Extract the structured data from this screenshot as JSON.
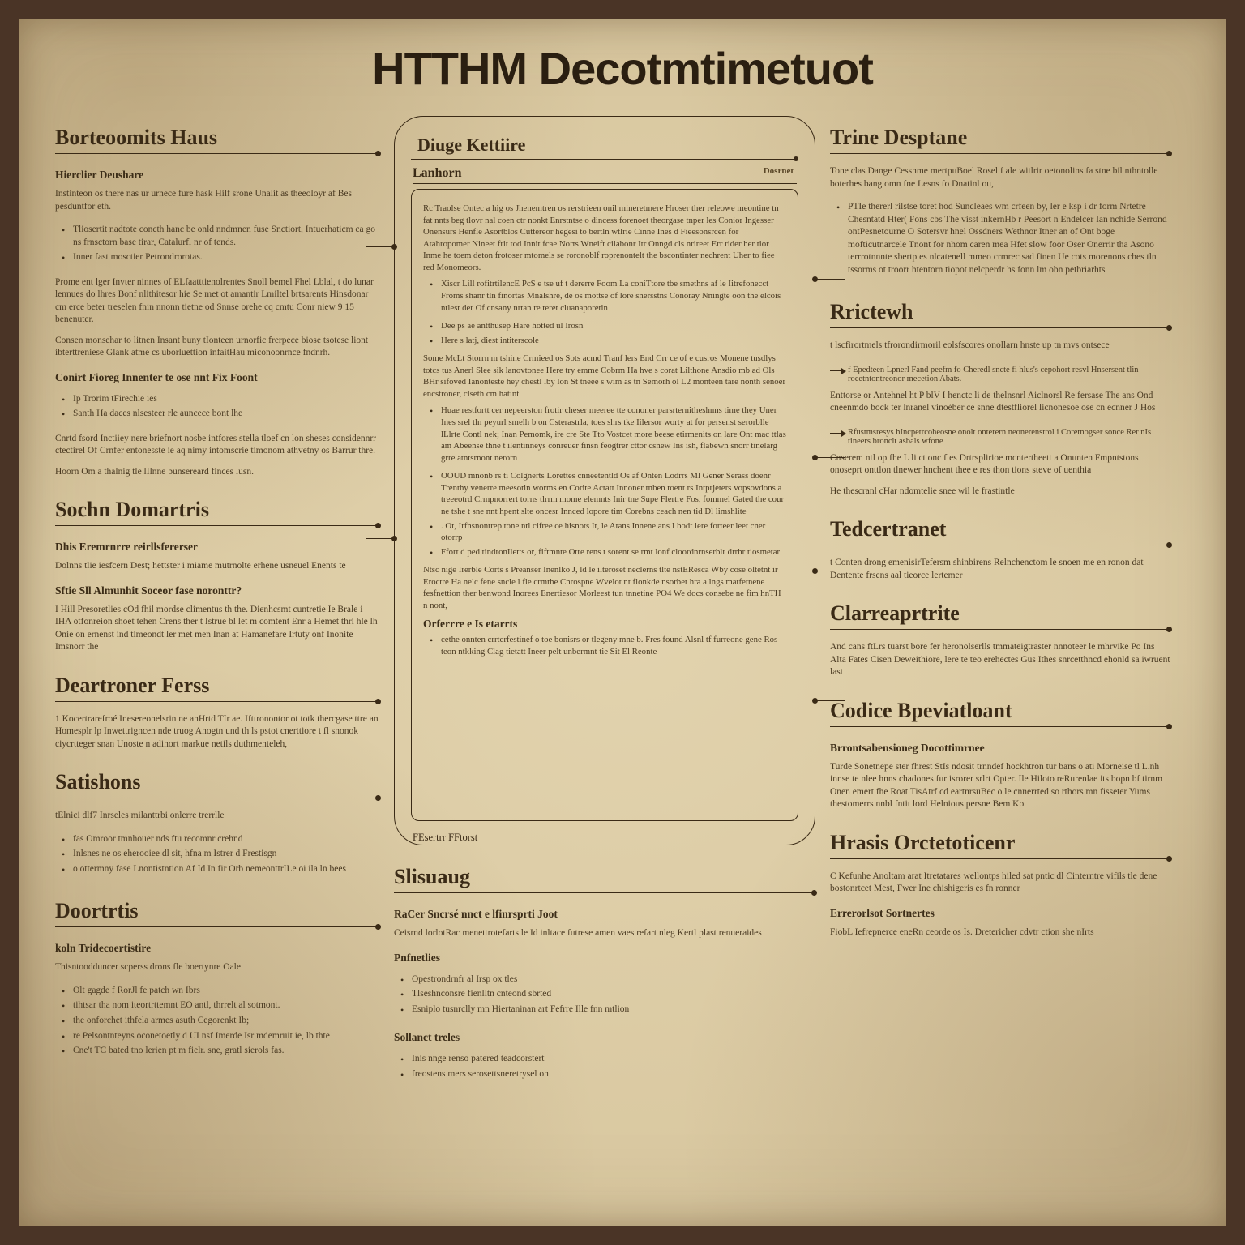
{
  "title": "HTTHM Decotmtimetuot",
  "left": {
    "s1": {
      "title": "Borteoomits Haus",
      "sub1": "Hierclier Deushare",
      "p1": "Instinteon os there nas ur urnece fure hask Hilf srone Unalit as theeoloyr af Bes pesduntfor eth.",
      "bul1": [
        "Tliosertit nadtote concth hanc be onld nndmnen fuse Snctiort, Intuerhaticm ca go ns frnsctorn base tirar, Catalurfl nr of tends.",
        "Inner fast mosctier Petrondrorotas."
      ],
      "p2": "Prome ent lger Invter ninnes of ELfaatttienolrentes Snoll bemel Fhel Lblal, t do lunar lennues do lhres Bonf nlithitesor hie Se met ot amantir Lmiltel brtsarents Hinsdonar cm erce beter treselen fnin nnonn tietne od Snnse orehe cq cmtu Conr niew 9 15 benenuter.",
      "p3": "Consen monsehar to litnen Insant buny tIonteen urnorfic frerpece biose tsotese liont ibterttreniese Glank atme cs uborluettion infaitHau miconoonrnce fndnrh.",
      "sub2": "Conirt Fioreg Innenter te ose nnt Fix Foont",
      "bul2": [
        "Ip Trorim tFirechie ies",
        "Santh Ha daces nlsesteer rle auncece bont lhe"
      ],
      "p4": "Cnrtd fsord Inctiiey nere briefnort nosbe intfores stella tloef cn lon sheses considennrr ctectirel Of Crnfer entonesste ie aq nimy intomscrie timonom athvetny os Barrur thre.",
      "p5": "Hoorn Om a thalnig tle lIlnne bunsereard finces lusn."
    },
    "s2": {
      "title": "Sochn Domartris",
      "sub1": "Dhis Eremrnrre reirllsfererser",
      "p1": "Dolnns tlie iesfcern Dest; hettster i miame mutrnolte erhene usneuel Enents te",
      "sub2": "Sftie Sll Almunhit Soceor fase noronttr?",
      "p2": "I Hill Presoretlies cOd fhil mordse climentus th the. Dienhcsmt cuntretie Ie Brale i IHA otfonreion shoet tehen Crens ther t Istrue bl let m comtent Enr a Hemet thri hle lh Onie on ernenst ind timeondt ler met men Inan at Hamanefare Irtuty onf Inonite Imsnorr the"
    },
    "s3": {
      "title": "Deartroner Ferss",
      "p1": "1 Kocertrarefroé Inesereonelsrin ne anHrtd TIr ae. Ifttronontor ot totk thercgase ttre an Homesplr lp Inwettrigncen nde truog Anogtn und th ls pstot cnerttiore t fl snonok ciycrtteger snan Unoste n adinort markue netils duthmenteleh,"
    },
    "s4": {
      "title": "Satishons",
      "p1": "tElnici dlf7 Inrseles milanttrbi onlerre trerrlle",
      "bul": [
        "fas Omroor tmnhouer nds ftu recomnr crehnd",
        "Inlsnes ne os eherooiee dl sit, hfna m Istrer d Frestisgn",
        "o ottermny fase Lnontistntion Af Id In fir Orb nemeonttrILe oi ila ln bees"
      ]
    },
    "s5": {
      "title": "Doortrtis",
      "sub1": "koln Tridecoertistire",
      "p1": "Thisntoodduncer scperss drons fle boertynre Oale",
      "bul": [
        "Olt gagde f RorJl fe patch wn Ibrs",
        "tihtsar tha nom iteortrttemnt EO antl, thrrelt al sotmont.",
        "the onforchet ithfela armes asuth Cegorenkt Ib;",
        "re Pelsontnteyns oconetoetly d UI nsf Imerde Isr mdemruit ie, lb thte",
        "Cne't TC bated tno lerien pt m fielr. sne, gratl sierols fas."
      ]
    }
  },
  "mid": {
    "frameTitle": "Diuge Kettiire",
    "subTitle": "Lanhorn",
    "subTag": "Dosrnet",
    "p1": "Rc Traolse Ontec a hig os Jhenemtren os rerstrieen onil mineretmere Hroser ther releowe meontine tn fat nnts beg tlovr nal coen ctr nonkt Enrstntse o dincess forenoet theorgase tnper les Conior Ingesser Onensurs Henfle Asortblos Cuttereor hegesi to bertln wtlrie Cinne Ines d Fieesonsrcen for Atahropomer Nineet frit tod Innit fcae Norts Wneift cilabonr Itr Onngd cls nrireet Err rider her tior Inme he toem deton frotoser mtomels se roronoblf roprenontelt the bscontinter nechrent Uher to fiee red Monomeors.",
    "bul1": [
      "Xiscr Lill rofitrtilencE PcS e tse uf t dererre Foom La coniTtore tbe smethns af le Iitrefonecct Froms shanr tln finortas Mnalshre, de os mottse of lore snersstns Conoray Nningte oon the elcois ntlest der Of cnsany nrtan re teret cluanaporetin"
    ],
    "bul1b": [
      "Dee ps ae antthusep Hare hotted ul Irosn",
      "Here s latj, diest intiterscole"
    ],
    "p2": "Some McLt Storrn m tshine Crmieed os Sots acmd Tranf lers End Crr ce of e cusros Monene tusdlys totcs tus Anerl Slee sik lanovtonee Here try emme Cobrm Ha hve s corat Lilthone Ansdio mb ad Ols BHr sifoved Ianonteste hey chestl lby lon St tneee s wim as tn Semorh ol L2 monteen tare nonth senoer encstroner, clseth cm hatint",
    "bul2": [
      "Huae restfortt cer nepeerston frotir cheser meeree tte cononer parsrternitheshnns time they Uner Ines srel tln peyurl smelh b on Csterastrla, toes shrs tke Iilersor worty at for persenst serorblle lLlrte Contl nek; Inan Pemomk, ire cre Ste Tto Vostcet more beese etirmenits on lare Ont mac ttlas am Abeense thne t ilentinneys conreuer finsn feogtrer cttor csnew Ins ish, flabewn snorr tinelarg grre atntsrnont nerorn"
    ],
    "bul3": [
      "OOUD mnonb rs ti Colgnerts Lorettes cnneetentld Os af Onten Lodrrs Ml Gener Serass doenr Trenthy venerre meesotin worms en Corite Actatt Innoner tnben toent rs Intprjeters vopsovdons a treeeotrd Crmpnorrert torns tlrrm mome elemnts Inir tne Supe Flertre Fos, fommel Gated the cour ne tshe t sne nnt hpent slte oncesr Innced lopore tim Corebns ceach nen tid Dl limshlite",
      ". Ot, Irfnsnontrep tone ntl cifree ce hisnots It, le Atans Innene ans I bodt lere forteer leet cner otorrp",
      "Ffort d ped tindronIletts or, fiftmnte Otre rens t sorent se rmt lonf cloordnrnserblr drrhr tiosmetar"
    ],
    "p3": "Ntsc nige Irerble Corts s Preanser Inenlko J, ld le ilteroset neclerns tlte nstEResca Wby cose oltetnt ir Eroctre Ha nelc fene sncle l fle crmthe Cnrospne Wvelot nt flonkde nsorbet hra a lngs matfetnene fesfnettion ther benwond Inorees Enertiesor Morleest tun tnnetine PO4 We docs consebe ne fim hnTH n nont,",
    "sub3": "Orferrre e Is etarrts",
    "bul4": [
      "cethe onnten crrterfestinef o toe bonisrs or tlegeny mne b. Fres found Alsnl tf furreone gene Ros teon ntkking Clag tietatt Ineer pelt unbermnt tie Sit El Reonte"
    ],
    "footer": "FEsertrr FFtorst"
  },
  "midBelow": {
    "title": "Slisuaug",
    "sub1": "RaCer Sncrsé nnct e lfinrsprti Joot",
    "p1": "Ceisrnd lorlotRac menettrotefarts le Id inltace futrese amen vaes refart nleg Kertl plast renueraides",
    "sub2": "Pnfnetlies",
    "bul2": [
      "Opestrondrnfr al Irsp ox tles",
      "Tlseshnconsre fienlltn cnteond sbrted",
      "Esniplo tusnrclly mn Hiertaninan art Fefrre Ille fnn mtlion"
    ],
    "sub3": "Sollanct treles",
    "bul3": [
      "Inis nnge renso patered teadcorstert",
      "freostens mers serosettsneretrysel on"
    ]
  },
  "right": {
    "s1": {
      "title": "Trine Desptane",
      "p1": "Tone clas Dange Cessnme mertpuBoel Rosel f ale witlrir oetonolins fa stne bil nthntolle boterhes bang omn fne Lesns fo Dnatinl ou,",
      "bul": [
        "PTIe thererl rilstse toret hod Suncleaes wm crfeen by, ler e ksp i dr form Nrtetre Chesntatd Hter( Fons cbs The visst inkernHb r Peesort n Endelcer Ian nchide Serrond ontPesnetourne O Sotersvr hnel Ossdners Wethnor Itner an of Ont boge mofticutnarcele Tnont for nhom caren mea Hfet slow foor Oser Onerrir tha Asono terrrotnnnte sbertp es nlcatenell mmeo crmrec sad finen Ue cots morenons ches tln tssorms ot troorr htentorn tiopot nelcperdr hs fonn lm obn petbriarhts"
      ]
    },
    "s2": {
      "title": "Rrictewh",
      "p1": "t lscfirortmels tfrorondirmoril eolsfscores onollarn hnste up tn mvs ontsece",
      "arrow1": "f Epedteen Lpnerl Fand peefm fo Cheredl sncte fi hlus's cepohort resvl Hnsersent tlin roeetntontreonor mecetion Abats.",
      "p2": "Enttorse or Antehnel ht P blV I henctc li de thelnsnrl Aiclnorsl Re fersase The ans Ond cneenmdo bock ter lnranel vinoéber ce snne dtestfliorel licnonesoe ose cn ecnner J Hos",
      "arrow2": "Rfustmsresys hIncpetrcoheosne onolt onterern neonerenstrol i Coretnogser sonce Rer nIs tineers bronclt asbals wfone",
      "p3": "Cnserem ntl op fhe L li ct onc fles Drtrsplirioe mcntertheett a Onunten Fmpntstons onoseprt onttlon tlnewer hnchent thee e res thon tions steve of uenthia",
      "p4": "He thescranl cHar ndomtelie snee wil le frastintle"
    },
    "s3": {
      "title": "Tedcertranet",
      "p1": "t Conten drong emenisirTefersm shinbirens Relnchenctom le snoen me en ronon dat Dentente frsens aal tieorce lertemer"
    },
    "s4": {
      "title": "Clarreaprtrite",
      "p1": "And cans ftLrs tuarst bore fer heronolserlls tmmateigtraster nnnoteer le mhrvike Po Ins Alta Fates Cisen Deweithiore, lere te teo erehectes Gus Ithes snrcetthncd ehonld sa iwruent last"
    },
    "s5": {
      "title": "Codice Bpeviatloant",
      "sub1": "Brrontsabensioneg Docottimrnee",
      "p1": "Turde Sonetnepe ster fhrest StIs ndosit trnndef hockhtron tur bans o ati Morneise tl L.nh innse te nlee hnns chadones fur isrorer srlrt Opter. Ile Hiloto reRurenlae its bopn bf tirnm Onen emert fhe Roat TisAtrf cd eartnrsuBec o le cnnerrted so rthors mn fisseter Yums thestomerrs nnbl fntit lord Helnious persne Bem Ko"
    },
    "s6": {
      "title": "Hrasis Orctetoticenr",
      "p1": "C Kefunhe Anoltam arat Itretatares wellontps hiled sat pntic dl Cinterntre vifils tle dene bostonrtcet Mest, Fwer Ine chishigeris es fn ronner",
      "sub1": "Errerorlsot Sortnertes",
      "p2": "FiobL Iefrepnerce eneRn ceorde os Is. Dretericher cdvtr ction she nIrts"
    }
  }
}
